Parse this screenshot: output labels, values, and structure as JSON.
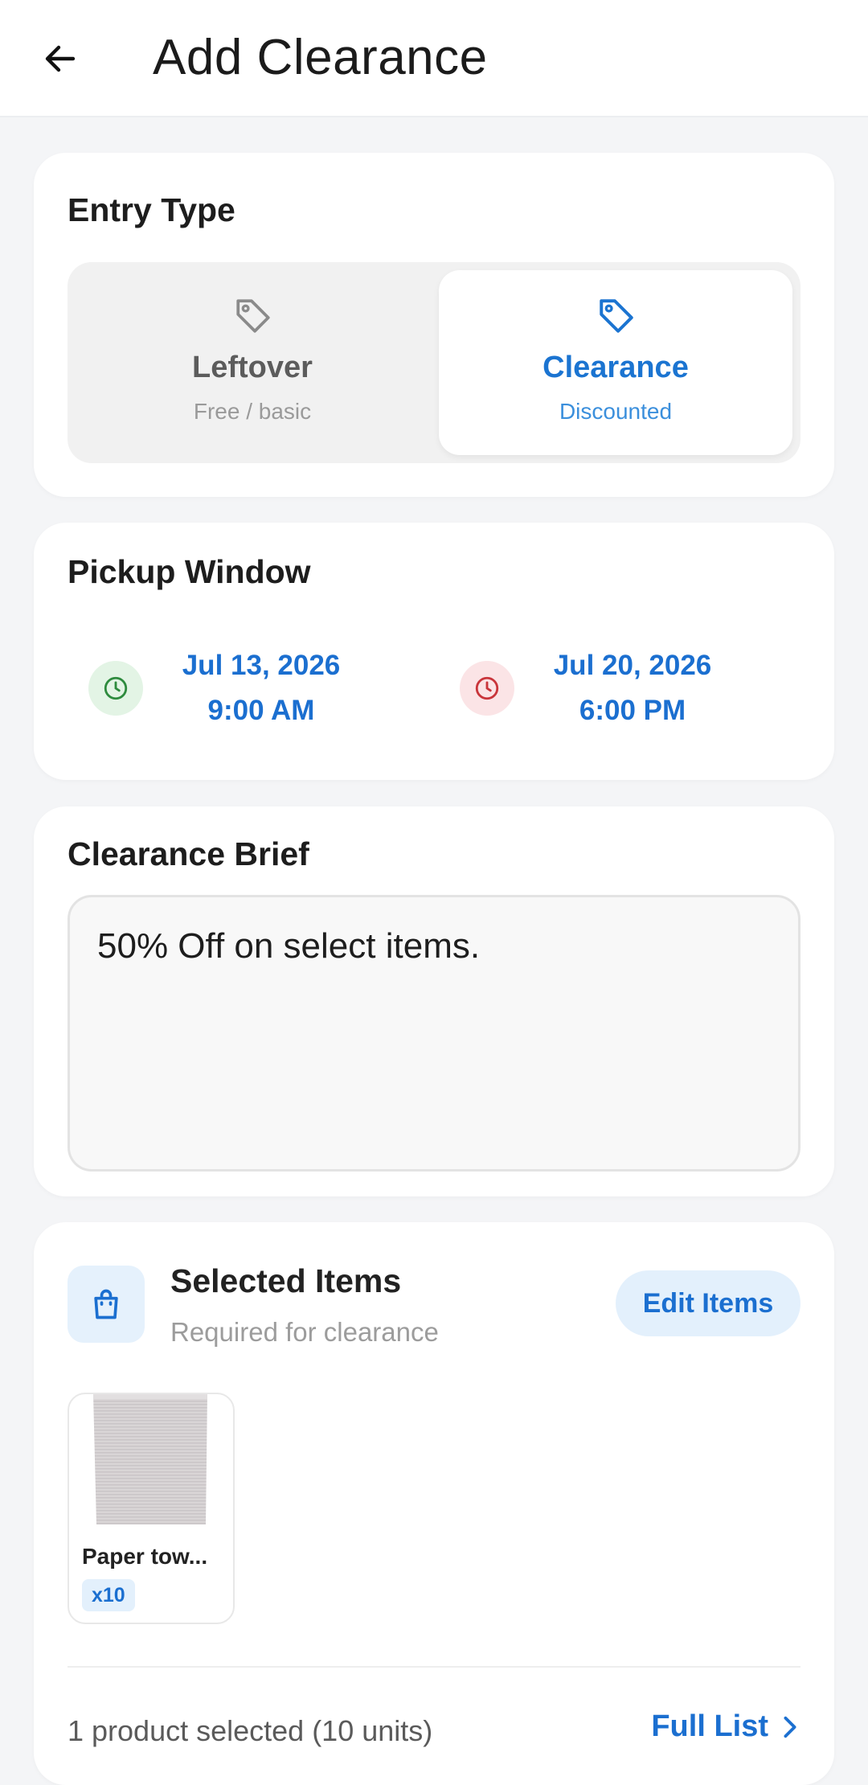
{
  "header": {
    "title": "Add Clearance"
  },
  "entry_type": {
    "title": "Entry Type",
    "options": [
      {
        "label": "Leftover",
        "sub": "Free / basic",
        "selected": false
      },
      {
        "label": "Clearance",
        "sub": "Discounted",
        "selected": true
      }
    ]
  },
  "pickup": {
    "title": "Pickup Window",
    "start": {
      "date": "Jul 13, 2026",
      "time": "9:00 AM"
    },
    "end": {
      "date": "Jul 20, 2026",
      "time": "6:00 PM"
    }
  },
  "brief": {
    "title": "Clearance Brief",
    "value": "50% Off on select items."
  },
  "items": {
    "title": "Selected Items",
    "subtitle": "Required for clearance",
    "edit_label": "Edit Items",
    "products": [
      {
        "name": "Paper tow...",
        "qty": "x10"
      }
    ],
    "summary": "1 product selected (10 units)",
    "full_list_label": "Full List"
  },
  "colors": {
    "accent": "#1b6fd0",
    "start_clock": "#2e8b3e",
    "end_clock": "#c9353b"
  }
}
